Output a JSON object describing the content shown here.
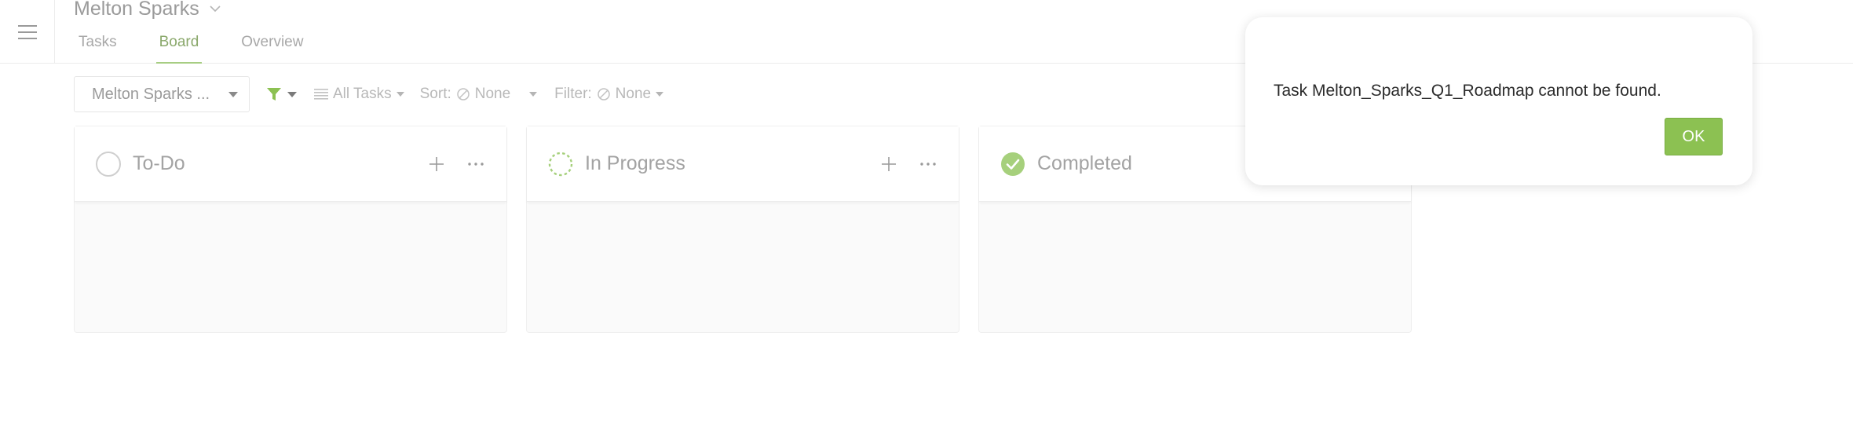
{
  "header": {
    "menu_icon": "hamburger-icon",
    "project_title": "Melton Sparks",
    "tabs": [
      {
        "label": "Tasks"
      },
      {
        "label": "Board"
      },
      {
        "label": "Overview"
      }
    ],
    "active_tab": "Board"
  },
  "toolbar": {
    "project_select_value": "Melton Sparks ...",
    "all_tasks_label": "All Tasks",
    "sort_label": "Sort:",
    "sort_value": "None",
    "filter_label": "Filter:",
    "filter_value": "None"
  },
  "columns": [
    {
      "title": "To-Do",
      "status_icon": "empty-circle-icon"
    },
    {
      "title": "In Progress",
      "status_icon": "dashed-circle-icon"
    },
    {
      "title": "Completed",
      "status_icon": "check-circle-icon"
    }
  ],
  "dialog": {
    "message": "Task Melton_Sparks_Q1_Roadmap cannot be found.",
    "ok_label": "OK"
  },
  "colors": {
    "accent_green": "#8cc152",
    "tab_underline": "#a7cd83",
    "muted_text": "#9a9a9a"
  }
}
